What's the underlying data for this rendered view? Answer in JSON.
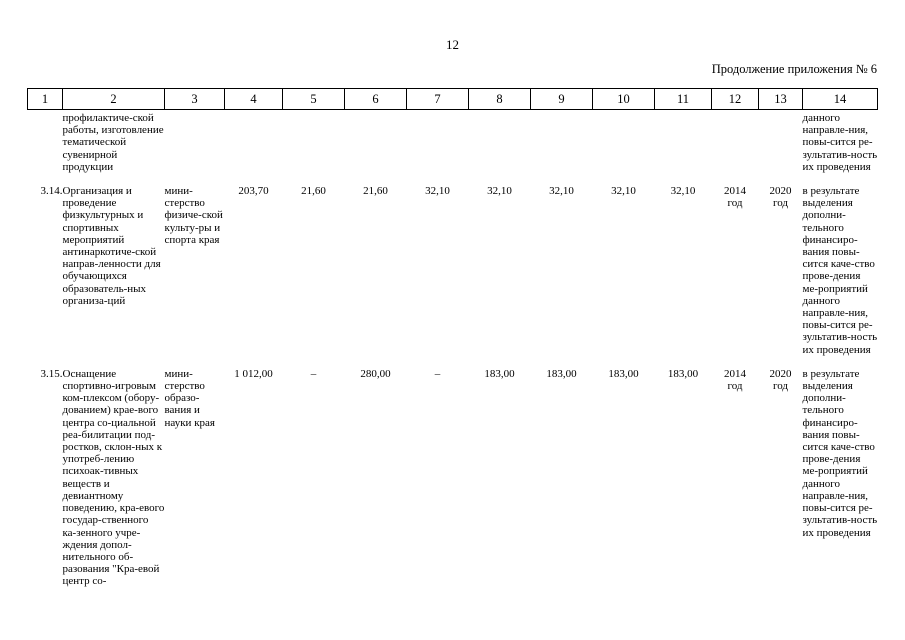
{
  "document": {
    "page_number": "12",
    "continuation_label": "Продолжение приложения № 6"
  },
  "table": {
    "column_numbers": [
      "1",
      "2",
      "3",
      "4",
      "5",
      "6",
      "7",
      "8",
      "9",
      "10",
      "11",
      "12",
      "13",
      "14"
    ],
    "rows": [
      {
        "id": "",
        "name": "профилактиче-ской работы, изготовление тематической сувенирной продукции",
        "org": "",
        "v4": "",
        "v5": "",
        "v6": "",
        "v7": "",
        "v8": "",
        "v9": "",
        "v10": "",
        "v11": "",
        "year_start": "",
        "year_start_unit": "",
        "year_end": "",
        "year_end_unit": "",
        "result": "данного направле-ния, повы-сится ре-зультатив-ность их проведения"
      },
      {
        "id": "3.14.",
        "name": "Организация и проведение физкультурных и спортивных мероприятий антинаркотиче-ской направ-ленности для обучающихся образователь-ных организа-ций",
        "org": "мини-стерство физиче-ской культу-ры и спорта края",
        "v4": "203,70",
        "v5": "21,60",
        "v6": "21,60",
        "v7": "32,10",
        "v8": "32,10",
        "v9": "32,10",
        "v10": "32,10",
        "v11": "32,10",
        "year_start": "2014",
        "year_start_unit": "год",
        "year_end": "2020",
        "year_end_unit": "год",
        "result": "в результате выделения дополни-тельного финансиро-вания повы-сится каче-ство прове-дения ме-роприятий данного направле-ния, повы-сится ре-зультатив-ность их проведения"
      },
      {
        "id": "3.15.",
        "name": "Оснащение спортивно-игровым ком-плексом (обору-дованием) крае-вого центра со-циальной реа-билитации под-ростков, склон-ных к употреб-лению психоак-тивных веществ и девиантному поведению, кра-евого государ-ственного ка-зенного учре-ждения допол-нительного об-разования \"Кра-евой центр со-",
        "org": "мини-стерство образо-вания и науки края",
        "v4": "1 012,00",
        "v5": "–",
        "v6": "280,00",
        "v7": "–",
        "v8": "183,00",
        "v9": "183,00",
        "v10": "183,00",
        "v11": "183,00",
        "year_start": "2014",
        "year_start_unit": "год",
        "year_end": "2020",
        "year_end_unit": "год",
        "result": "в результате выделения дополни-тельного финансиро-вания повы-сится каче-ство прове-дения ме-роприятий данного направле-ния, повы-сится ре-зультатив-ность их проведения"
      }
    ]
  }
}
